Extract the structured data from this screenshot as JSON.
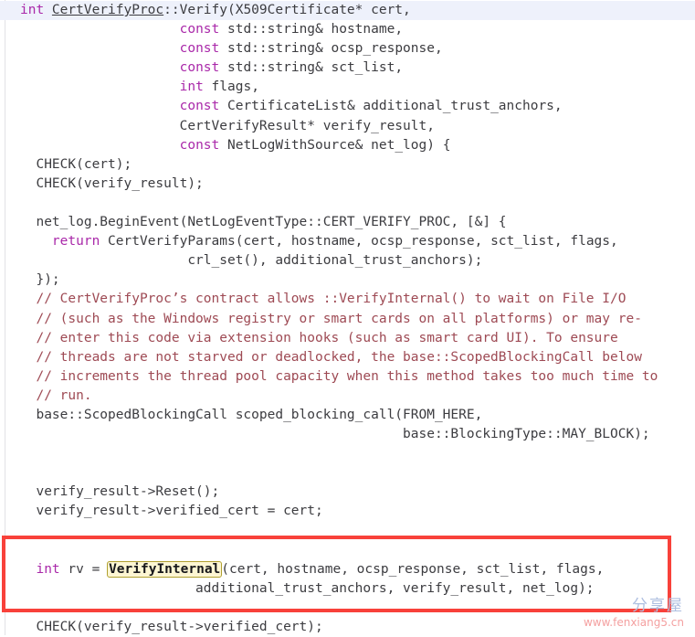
{
  "viewer": {
    "title": "CertVerifyProc::Verify source listing",
    "language": "C++",
    "colors": {
      "background": "#ffffff",
      "text": "#3c3c40",
      "keyword": "#a928a9",
      "comment": "#9e4a54",
      "current_line_highlight": "#eef1fb",
      "occurrence_highlight_bg": "#fdf6d3",
      "occurrence_highlight_border": "#b0a030",
      "annotation_box": "#f8413a",
      "watermark_cn": "#aebfe0",
      "watermark_url": "#f4a0a0"
    }
  },
  "annotation": {
    "shape": "rectangle",
    "color": "#f8413a",
    "covers_lines": [
      30,
      31
    ]
  },
  "occurrence_highlight": {
    "token": "VerifyInternal",
    "line": 30
  },
  "watermark": {
    "cn": "分享屋",
    "url": "www.fenxiang5.cn"
  },
  "code": {
    "current_line": 1,
    "lines": [
      {
        "n": 1,
        "current": true,
        "tokens": [
          {
            "t": "int ",
            "c": "kw"
          },
          {
            "t": "CertVerifyProc",
            "c": "link"
          },
          {
            "t": "::Verify(X509Certificate* cert,",
            "c": "plain"
          }
        ]
      },
      {
        "n": 2,
        "tokens": [
          {
            "t": "                    ",
            "c": "plain"
          },
          {
            "t": "const",
            "c": "kw"
          },
          {
            "t": " std::string& hostname,",
            "c": "plain"
          }
        ]
      },
      {
        "n": 3,
        "tokens": [
          {
            "t": "                    ",
            "c": "plain"
          },
          {
            "t": "const",
            "c": "kw"
          },
          {
            "t": " std::string& ocsp_response,",
            "c": "plain"
          }
        ]
      },
      {
        "n": 4,
        "tokens": [
          {
            "t": "                    ",
            "c": "plain"
          },
          {
            "t": "const",
            "c": "kw"
          },
          {
            "t": " std::string& sct_list,",
            "c": "plain"
          }
        ]
      },
      {
        "n": 5,
        "tokens": [
          {
            "t": "                    ",
            "c": "plain"
          },
          {
            "t": "int",
            "c": "kw"
          },
          {
            "t": " flags,",
            "c": "plain"
          }
        ]
      },
      {
        "n": 6,
        "tokens": [
          {
            "t": "                    ",
            "c": "plain"
          },
          {
            "t": "const",
            "c": "kw"
          },
          {
            "t": " CertificateList& additional_trust_anchors,",
            "c": "plain"
          }
        ]
      },
      {
        "n": 7,
        "tokens": [
          {
            "t": "                    CertVerifyResult* verify_result,",
            "c": "plain"
          }
        ]
      },
      {
        "n": 8,
        "tokens": [
          {
            "t": "                    ",
            "c": "plain"
          },
          {
            "t": "const",
            "c": "kw"
          },
          {
            "t": " NetLogWithSource& net_log) {",
            "c": "plain"
          }
        ]
      },
      {
        "n": 9,
        "tokens": [
          {
            "t": "  CHECK(cert);",
            "c": "plain"
          }
        ]
      },
      {
        "n": 10,
        "tokens": [
          {
            "t": "  CHECK(verify_result);",
            "c": "plain"
          }
        ]
      },
      {
        "n": 11,
        "tokens": []
      },
      {
        "n": 12,
        "tokens": [
          {
            "t": "  net_log.BeginEvent(NetLogEventType::CERT_VERIFY_PROC, [&] {",
            "c": "plain"
          }
        ]
      },
      {
        "n": 13,
        "tokens": [
          {
            "t": "    ",
            "c": "plain"
          },
          {
            "t": "return",
            "c": "kw"
          },
          {
            "t": " CertVerifyParams(cert, hostname, ocsp_response, sct_list, flags,",
            "c": "plain"
          }
        ]
      },
      {
        "n": 14,
        "tokens": [
          {
            "t": "                     crl_set(), additional_trust_anchors);",
            "c": "plain"
          }
        ]
      },
      {
        "n": 15,
        "tokens": [
          {
            "t": "  });",
            "c": "plain"
          }
        ]
      },
      {
        "n": 16,
        "tokens": [
          {
            "t": "  // CertVerifyProc’s contract allows ::VerifyInternal() to wait on File I/O",
            "c": "comment"
          }
        ]
      },
      {
        "n": 17,
        "tokens": [
          {
            "t": "  // (such as the Windows registry or smart cards on all platforms) or may re-",
            "c": "comment"
          }
        ]
      },
      {
        "n": 18,
        "tokens": [
          {
            "t": "  // enter this code via extension hooks (such as smart card UI). To ensure",
            "c": "comment"
          }
        ]
      },
      {
        "n": 19,
        "tokens": [
          {
            "t": "  // threads are not starved or deadlocked, the base::ScopedBlockingCall below",
            "c": "comment"
          }
        ]
      },
      {
        "n": 20,
        "tokens": [
          {
            "t": "  // increments the thread pool capacity when this method takes too much time to",
            "c": "comment"
          }
        ]
      },
      {
        "n": 21,
        "tokens": [
          {
            "t": "  // run.",
            "c": "comment"
          }
        ]
      },
      {
        "n": 22,
        "tokens": [
          {
            "t": "  base::ScopedBlockingCall scoped_blocking_call(FROM_HERE,",
            "c": "plain"
          }
        ]
      },
      {
        "n": 23,
        "tokens": [
          {
            "t": "                                                base::BlockingType::MAY_BLOCK);",
            "c": "plain"
          }
        ]
      },
      {
        "n": 24,
        "tokens": []
      },
      {
        "n": 25,
        "tokens": []
      },
      {
        "n": 26,
        "tokens": [
          {
            "t": "  verify_result->Reset();",
            "c": "plain"
          }
        ]
      },
      {
        "n": 27,
        "tokens": [
          {
            "t": "  verify_result->verified_cert = cert;",
            "c": "plain"
          }
        ]
      },
      {
        "n": 28,
        "tokens": []
      },
      {
        "n": 29,
        "tokens": []
      },
      {
        "n": 30,
        "tokens": [
          {
            "t": "  ",
            "c": "plain"
          },
          {
            "t": "int",
            "c": "kw"
          },
          {
            "t": " rv = ",
            "c": "plain"
          },
          {
            "t": "VerifyInternal",
            "c": "occurrence"
          },
          {
            "t": "(cert, hostname, ocsp_response, sct_list, flags,",
            "c": "plain"
          }
        ]
      },
      {
        "n": 31,
        "tokens": [
          {
            "t": "                      additional_trust_anchors, verify_result, net_log);",
            "c": "plain"
          }
        ]
      },
      {
        "n": 32,
        "tokens": []
      },
      {
        "n": 33,
        "tokens": [
          {
            "t": "  CHECK(verify_result->verified_cert);",
            "c": "plain"
          }
        ]
      }
    ]
  }
}
